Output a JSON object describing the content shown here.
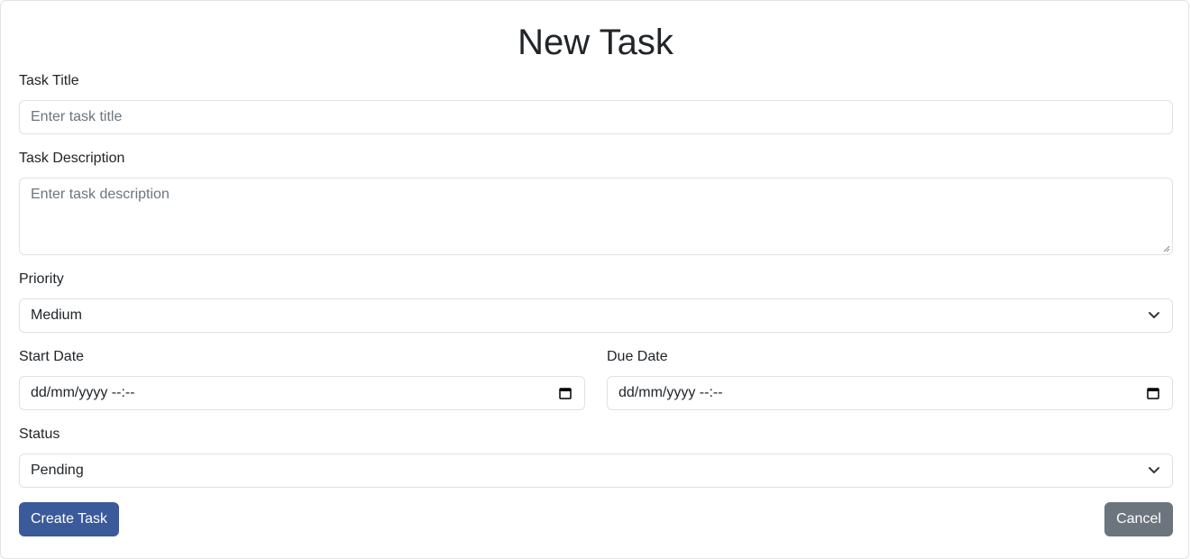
{
  "form": {
    "title": "New Task",
    "task_title": {
      "label": "Task Title",
      "placeholder": "Enter task title"
    },
    "task_description": {
      "label": "Task Description",
      "placeholder": "Enter task description"
    },
    "priority": {
      "label": "Priority",
      "value": "Medium"
    },
    "start_date": {
      "label": "Start Date",
      "value": "dd/mm/yyyy --:--"
    },
    "due_date": {
      "label": "Due Date",
      "value": "dd/mm/yyyy --:--"
    },
    "status": {
      "label": "Status",
      "value": "Pending"
    },
    "buttons": {
      "create": "Create Task",
      "cancel": "Cancel"
    }
  },
  "colors": {
    "primary": "#3a5a9a",
    "secondary": "#6c757d",
    "border": "#dee2e6"
  },
  "icons": {
    "select": "chevron-down-icon",
    "date": "calendar-icon"
  }
}
